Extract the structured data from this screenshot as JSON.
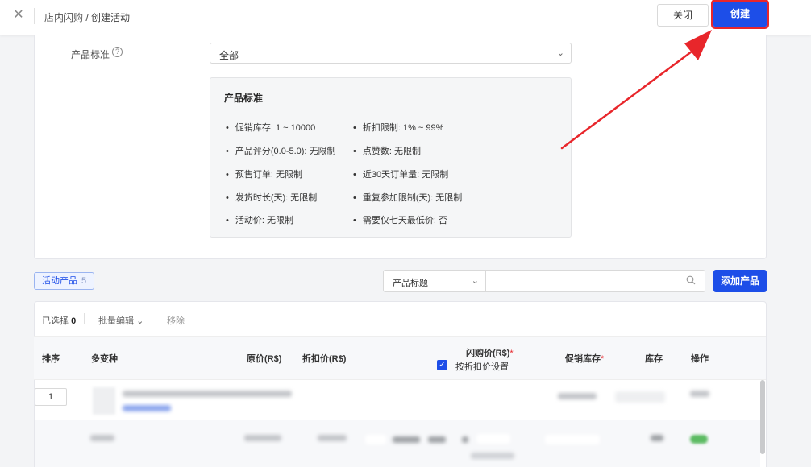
{
  "header": {
    "breadcrumb": "店内闪购",
    "current": "/ 创建活动",
    "close_label": "关闭",
    "create_label": "创建"
  },
  "product_standard": {
    "label": "产品标准",
    "select_value": "全部",
    "box_title": "产品标准",
    "left_criteria": [
      "促销库存: 1 ~ 10000",
      "产品评分(0.0-5.0): 无限制",
      "预售订单: 无限制",
      "发货时长(天): 无限制",
      "活动价: 无限制"
    ],
    "right_criteria": [
      "折扣限制: 1% ~ 99%",
      "点赞数: 无限制",
      "近30天订单量: 无限制",
      "重复参加限制(天): 无限制",
      "需要仅七天最低价: 否"
    ]
  },
  "toolbar": {
    "tab_label": "活动产品",
    "tab_count": "5",
    "filter_value": "产品标题",
    "search_placeholder": "",
    "add_label": "添加产品"
  },
  "table": {
    "selected_label": "已选择",
    "selected_count": "0",
    "batch_edit": "批量编辑",
    "remove": "移除",
    "headers": {
      "sort": "排序",
      "variant": "多变种",
      "original_price": "原价(R$)",
      "discount_price": "折扣价(R$)",
      "flash_price": "闪购价(R$)",
      "promo_stock": "促销库存",
      "stock": "库存",
      "action": "操作"
    },
    "set_by_discount": "按折扣价设置",
    "first_row_order": "1"
  },
  "colors": {
    "primary": "#1d4ee8",
    "annotation_red": "#e8262b"
  }
}
